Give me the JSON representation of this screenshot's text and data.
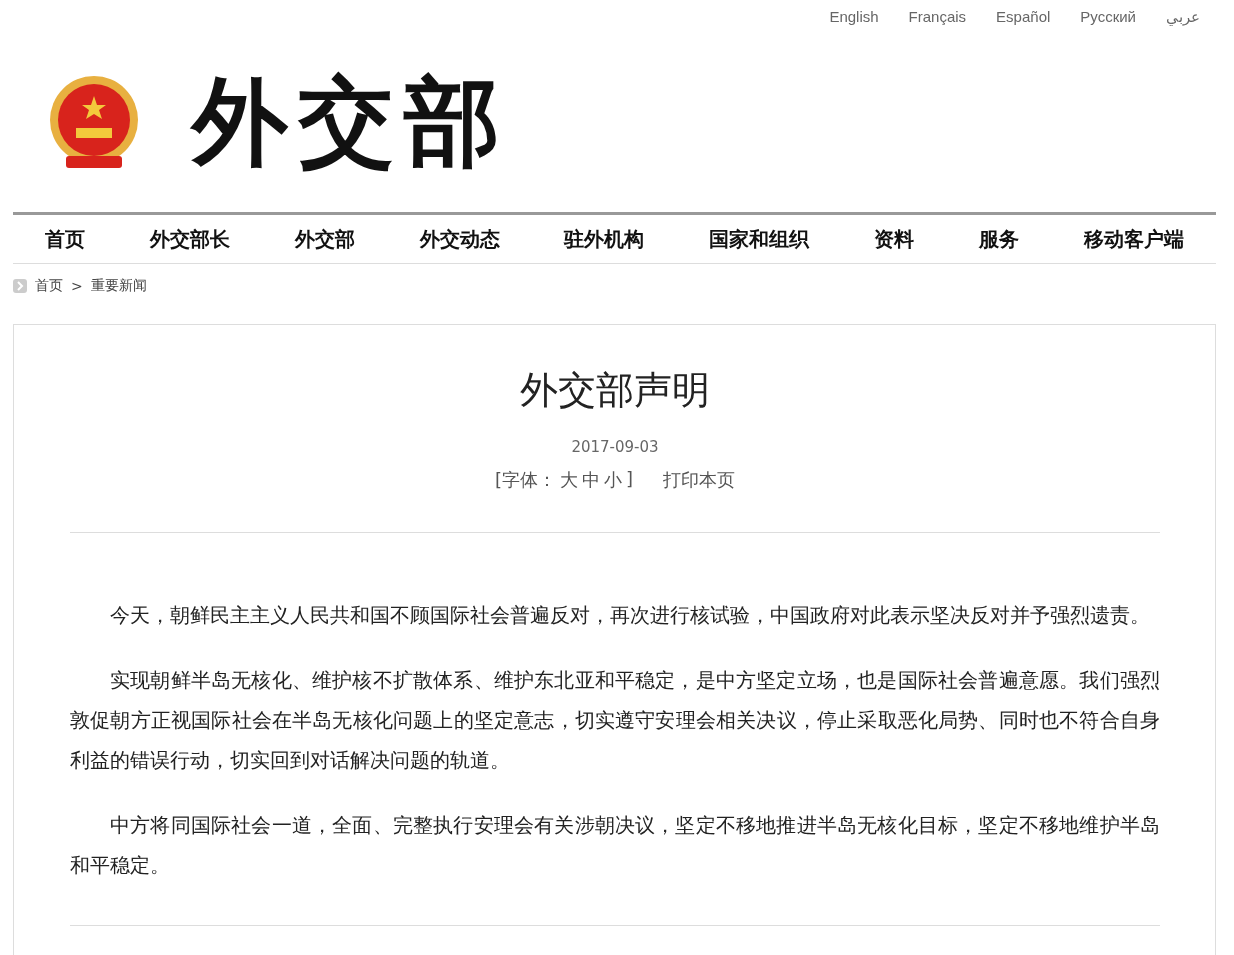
{
  "languages": [
    "English",
    "Français",
    "Español",
    "Русский",
    "عربي"
  ],
  "logo": {
    "text": "外交部"
  },
  "nav": [
    "首页",
    "外交部长",
    "外交部",
    "外交动态",
    "驻外机构",
    "国家和组织",
    "资料",
    "服务",
    "移动客户端"
  ],
  "breadcrumb": {
    "home": "首页",
    "separator": ">",
    "current": "重要新闻"
  },
  "article": {
    "title": "外交部声明",
    "date": "2017-09-03",
    "font_label_open": "[字体：",
    "font_sizes": [
      "大",
      "中",
      "小"
    ],
    "font_label_close": "]",
    "print": "打印本页",
    "paragraphs": [
      "今天，朝鲜民主主义人民共和国不顾国际社会普遍反对，再次进行核试验，中国政府对此表示坚决反对并予强烈遗责。",
      "实现朝鲜半岛无核化、维护核不扩散体系、维护东北亚和平稳定，是中方坚定立场，也是国际社会普遍意愿。我们强烈敦促朝方正视国际社会在半岛无核化问题上的坚定意志，切实遵守安理会相关决议，停止采取恶化局势、同时也不符合自身利益的错误行动，切实回到对话解决问题的轨道。",
      "中方将同国际社会一道，全面、完整执行安理会有关涉朝决议，坚定不移地推进半岛无核化目标，坚定不移地维护半岛和平稳定。"
    ]
  }
}
